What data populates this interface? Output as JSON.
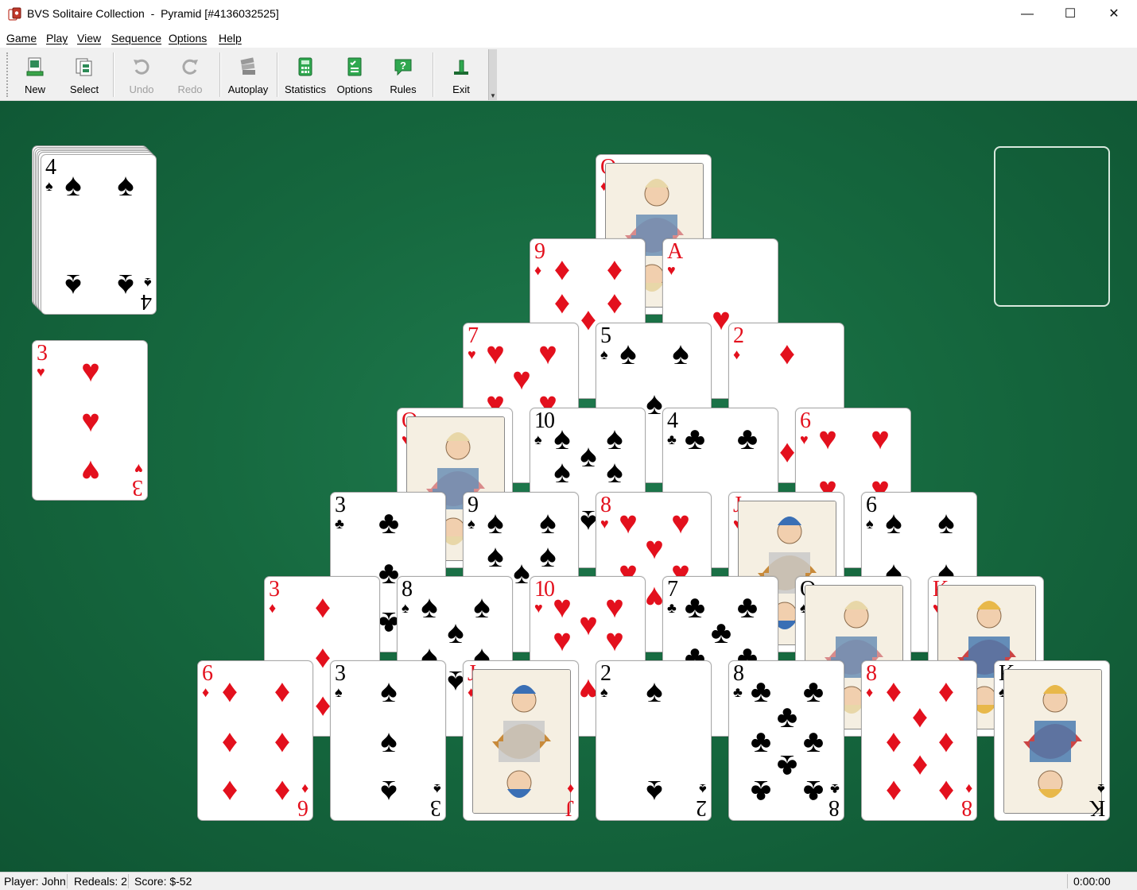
{
  "window": {
    "title": "BVS Solitaire Collection  -  Pyramid [#4136032525]",
    "minimize": "—",
    "maximize": "☐",
    "close": "✕"
  },
  "menu": {
    "game": "Game",
    "play": "Play",
    "view": "View",
    "sequence": "Sequence",
    "options": "Options",
    "help": "Help"
  },
  "toolbar": {
    "new": "New",
    "select": "Select",
    "undo": "Undo",
    "redo": "Redo",
    "autoplay": "Autoplay",
    "statistics": "Statistics",
    "options": "Options",
    "rules": "Rules",
    "exit": "Exit"
  },
  "colors": {
    "felt": "#16693f",
    "red_suit": "#e3101d",
    "black_suit": "#000000"
  },
  "stock": {
    "top_card": {
      "rank": "4",
      "suit": "♠",
      "color": "black"
    },
    "layered": true
  },
  "waste": {
    "top_card": {
      "rank": "3",
      "suit": "♥",
      "color": "red"
    }
  },
  "foundation": {
    "empty": true
  },
  "pyramid": [
    [
      {
        "rank": "Q",
        "suit": "♦",
        "color": "red"
      }
    ],
    [
      {
        "rank": "9",
        "suit": "♦",
        "color": "red"
      },
      {
        "rank": "A",
        "suit": "♥",
        "color": "red"
      }
    ],
    [
      {
        "rank": "7",
        "suit": "♥",
        "color": "red"
      },
      {
        "rank": "5",
        "suit": "♠",
        "color": "black"
      },
      {
        "rank": "2",
        "suit": "♦",
        "color": "red"
      }
    ],
    [
      {
        "rank": "Q",
        "suit": "♥",
        "color": "red"
      },
      {
        "rank": "10",
        "suit": "♠",
        "color": "black"
      },
      {
        "rank": "4",
        "suit": "♣",
        "color": "black"
      },
      {
        "rank": "6",
        "suit": "♥",
        "color": "red"
      }
    ],
    [
      {
        "rank": "3",
        "suit": "♣",
        "color": "black"
      },
      {
        "rank": "9",
        "suit": "♠",
        "color": "black"
      },
      {
        "rank": "8",
        "suit": "♥",
        "color": "red"
      },
      {
        "rank": "J",
        "suit": "♥",
        "color": "red"
      },
      {
        "rank": "6",
        "suit": "♠",
        "color": "black"
      }
    ],
    [
      {
        "rank": "3",
        "suit": "♦",
        "color": "red"
      },
      {
        "rank": "8",
        "suit": "♠",
        "color": "black"
      },
      {
        "rank": "10",
        "suit": "♥",
        "color": "red"
      },
      {
        "rank": "7",
        "suit": "♣",
        "color": "black"
      },
      {
        "rank": "Q",
        "suit": "♠",
        "color": "black"
      },
      {
        "rank": "K",
        "suit": "♥",
        "color": "red"
      }
    ],
    [
      {
        "rank": "6",
        "suit": "♦",
        "color": "red"
      },
      {
        "rank": "3",
        "suit": "♠",
        "color": "black"
      },
      {
        "rank": "J",
        "suit": "♦",
        "color": "red"
      },
      {
        "rank": "2",
        "suit": "♠",
        "color": "black"
      },
      {
        "rank": "8",
        "suit": "♣",
        "color": "black"
      },
      {
        "rank": "8",
        "suit": "♦",
        "color": "red"
      },
      {
        "rank": "K",
        "suit": "♠",
        "color": "black"
      }
    ]
  ],
  "status": {
    "player": "Player: John",
    "redeals": "Redeals: 2",
    "score": "Score: $-52",
    "timer": "0:00:00"
  }
}
